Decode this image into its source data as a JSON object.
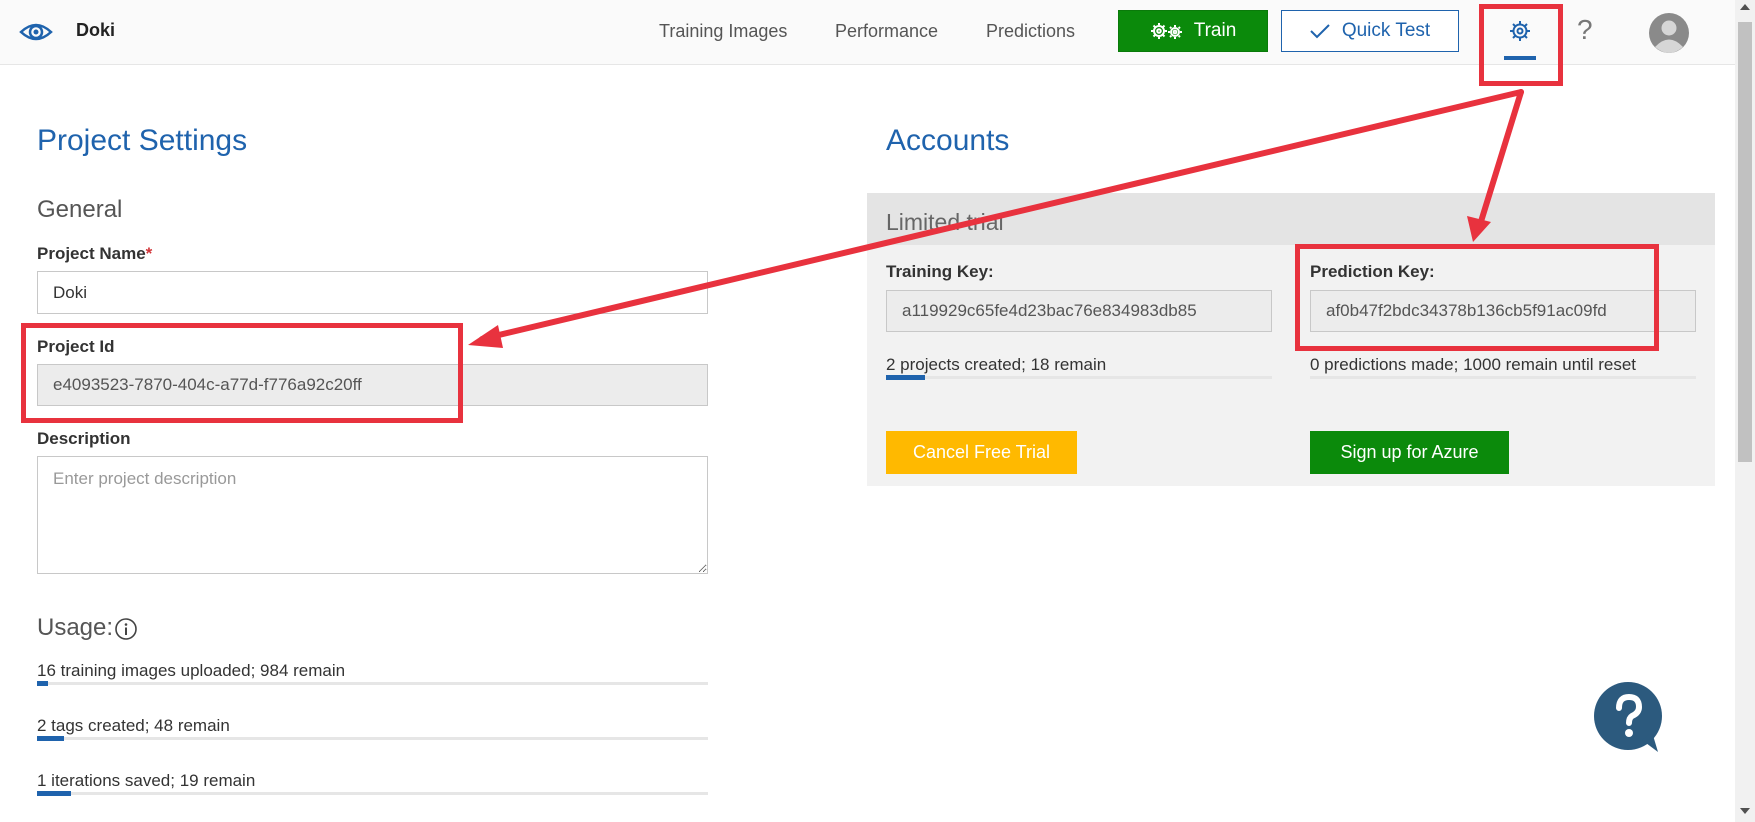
{
  "header": {
    "app_name": "Doki",
    "nav": [
      "Training Images",
      "Performance",
      "Predictions"
    ],
    "train_label": "Train",
    "quick_test_label": "Quick Test",
    "help_label": "?"
  },
  "settings": {
    "title": "Project Settings",
    "general_heading": "General",
    "project_name_label": "Project Name",
    "required_mark": "*",
    "project_name_value": "Doki",
    "project_id_label": "Project Id",
    "project_id_value": "e4093523-7870-404c-a77d-f776a92c20ff",
    "description_label": "Description",
    "description_placeholder": "Enter project description",
    "usage_heading": "Usage:",
    "usage": [
      {
        "text": "16 training images uploaded; 984 remain",
        "progress": 0.016
      },
      {
        "text": "2 tags created; 48 remain",
        "progress": 0.04
      },
      {
        "text": "1 iterations saved; 19 remain",
        "progress": 0.05
      }
    ]
  },
  "accounts": {
    "title": "Accounts",
    "trial_heading": "Limited trial",
    "training_key_label": "Training Key:",
    "training_key_value": "a119929c65fe4d23bac76e834983db85",
    "training_usage": {
      "text": "2 projects created; 18 remain",
      "progress": 0.1
    },
    "prediction_key_label": "Prediction Key:",
    "prediction_key_value": "af0b47f2bdc34378b136cb5f91ac09fd",
    "prediction_usage": {
      "text": "0 predictions made; 1000 remain until reset",
      "progress": 0
    },
    "cancel_label": "Cancel Free Trial",
    "azure_label": "Sign up for Azure"
  },
  "colors": {
    "accent": "#1f63ad",
    "train_green": "#0b8a0b",
    "cancel_yellow": "#ffb900",
    "highlight_red": "#e8323e"
  },
  "icons": [
    "eye-logo-icon",
    "gears-icon",
    "checkmark-icon",
    "gear-icon",
    "help-icon",
    "avatar-icon",
    "info-icon",
    "chat-help-icon"
  ]
}
